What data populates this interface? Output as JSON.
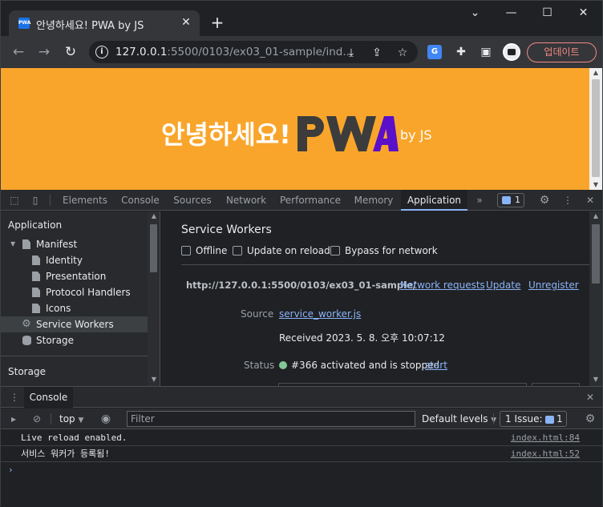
{
  "browser": {
    "tab_title": "안녕하세요! PWA by JS",
    "favicon_text": "PWA",
    "url_host": "127.0.0.1",
    "url_rest": ":5500/0103/ex03_01-sample/ind...",
    "update_label": "업데이트"
  },
  "page": {
    "hero": "안녕하세요!",
    "logo": "PWA",
    "byline": "by JS",
    "background": "#f9a52b"
  },
  "devtools": {
    "tabs": [
      "Elements",
      "Console",
      "Sources",
      "Network",
      "Performance",
      "Memory",
      "Application"
    ],
    "active_tab": "Application",
    "issue_count": "1",
    "sidebar": {
      "section1": "Application",
      "manifest": "Manifest",
      "manifest_children": [
        "Identity",
        "Presentation",
        "Protocol Handlers",
        "Icons"
      ],
      "service_workers": "Service Workers",
      "storage_item": "Storage",
      "section2": "Storage"
    },
    "sw": {
      "title": "Service Workers",
      "opt_offline": "Offline",
      "opt_update": "Update on reload",
      "opt_bypass": "Bypass for network",
      "scope": "http://127.0.0.1:5500/0103/ex03_01-sample/",
      "link_network": "Network requests",
      "link_update": "Update",
      "link_unregister": "Unregister",
      "source_label": "Source",
      "source_file": "service_worker.js",
      "received": "Received 2023. 5. 8. 오후 10:07:12",
      "status_label": "Status",
      "status_text": "#366 activated and is stopped",
      "start_link": "start"
    }
  },
  "console": {
    "tab": "Console",
    "context": "top",
    "filter_placeholder": "Filter",
    "levels": "Default levels",
    "issues_label": "1 Issue:",
    "issues_count": "1",
    "rows": [
      {
        "msg": "Live reload enabled.",
        "src": "index.html:84"
      },
      {
        "msg": "서비스 워커가 등록됨!",
        "src": "index.html:52"
      }
    ],
    "prompt": "›"
  }
}
